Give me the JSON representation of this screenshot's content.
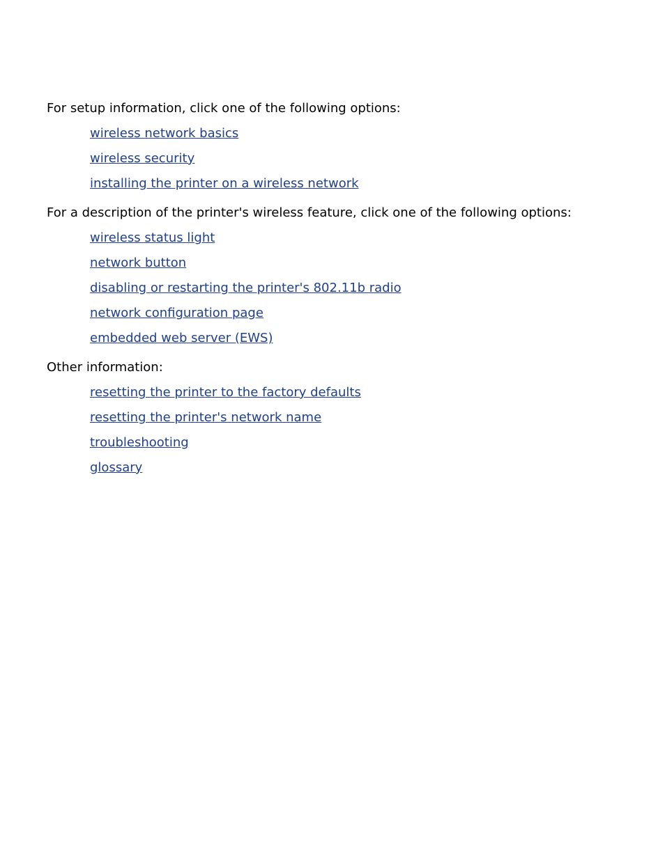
{
  "colors": {
    "link": "#1f3f8f",
    "text": "#000000"
  },
  "sections": [
    {
      "intro": "For setup information, click one of the following options:",
      "links": [
        "wireless network basics",
        "wireless security",
        "installing the printer on a wireless network"
      ]
    },
    {
      "intro": "For a description of the printer's wireless feature, click one of the following options:",
      "links": [
        "wireless status light",
        "network button",
        "disabling or restarting the printer's 802.11b radio",
        "network configuration page",
        "embedded web server (EWS)"
      ]
    },
    {
      "intro": "Other information:",
      "links": [
        "resetting the printer to the factory defaults",
        "resetting the printer's network name",
        "troubleshooting",
        "glossary"
      ]
    }
  ]
}
